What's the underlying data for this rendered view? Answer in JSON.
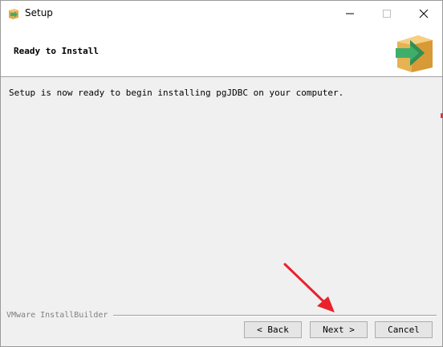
{
  "window": {
    "title": "Setup"
  },
  "header": {
    "title": "Ready to Install"
  },
  "content": {
    "message": "Setup is now ready to begin installing pgJDBC on your computer."
  },
  "footer": {
    "brand": "VMware InstallBuilder",
    "back_label": "< Back",
    "next_label": "Next >",
    "cancel_label": "Cancel"
  },
  "colors": {
    "arrow": "#e8232b",
    "box": "#e8b050",
    "arrow_green": "#3fae6a"
  }
}
